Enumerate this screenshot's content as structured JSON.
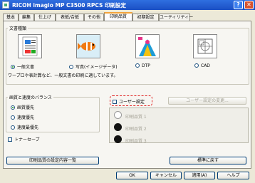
{
  "window": {
    "title": "RICOH imagio MP C3500 RPCS 印刷設定",
    "help_glyph": "?",
    "close_glyph": "✕"
  },
  "tabs": [
    {
      "label": "基本"
    },
    {
      "label": "編集"
    },
    {
      "label": "仕上げ"
    },
    {
      "label": "表紙/合紙"
    },
    {
      "label": "その他"
    },
    {
      "label": "印刷品質"
    },
    {
      "label": "初期設定"
    },
    {
      "label": "ユーティリティー"
    }
  ],
  "active_tab": "印刷品質",
  "doc_type": {
    "label": "文書種類",
    "options": [
      {
        "label": "一般文書",
        "selected": true
      },
      {
        "label": "写真(イメージデータ)",
        "selected": false
      },
      {
        "label": "DTP",
        "selected": false
      },
      {
        "label": "CAD",
        "selected": false
      }
    ],
    "description": "ワープロや表計算など、一般文書の印刷に適しています。"
  },
  "balance": {
    "label": "画質と速度のバランス",
    "options": [
      {
        "label": "画質優先",
        "selected": true
      },
      {
        "label": "速度優先",
        "selected": false
      },
      {
        "label": "速度最優先",
        "selected": false
      }
    ]
  },
  "toner_save": {
    "label": "トナーセーブ",
    "checked": false
  },
  "user_setting": {
    "label": "ユーザー設定",
    "checked": false
  },
  "user_change_button": "ユーザー設定の変更...",
  "presets": [
    {
      "label": "印刷品質 1"
    },
    {
      "label": "印刷品質 2"
    },
    {
      "label": "印刷品質 3"
    }
  ],
  "list_button": "印刷品質の設定内容一覧",
  "restore_button": "標準に戻す",
  "footer": {
    "ok": "OK",
    "cancel": "キャンセル",
    "apply": "適用(A)",
    "help": "ヘルプ"
  },
  "colors": {
    "title_bar": "#1b4fc4",
    "tab_highlight": "#f2a33a",
    "highlight_box": "#e02020"
  }
}
